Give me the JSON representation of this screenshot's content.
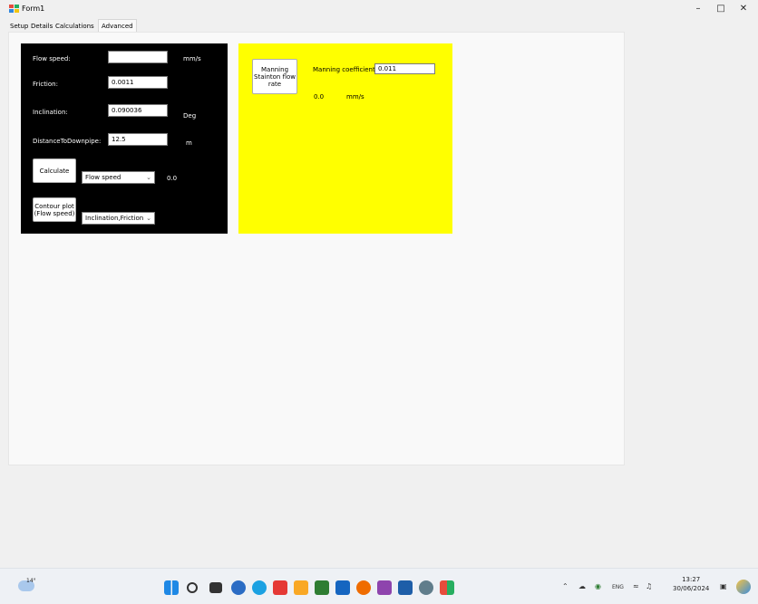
{
  "window": {
    "title": "Form1",
    "minimize": "–",
    "maximize": "□",
    "close": "✕"
  },
  "tabs": [
    "Setup",
    "Details",
    "Calculations",
    "Advanced"
  ],
  "black_panel": {
    "flow_speed_label": "Flow speed:",
    "flow_speed_value": "",
    "flow_speed_unit": "mm/s",
    "friction_label": "Friction:",
    "friction_value": "0.0011",
    "inclination_label": "Inclination:",
    "inclination_value": "0.090036",
    "inclination_unit": "Deg",
    "distance_label": "DistanceToDownpipe:",
    "distance_value": "12.5",
    "distance_unit": "m",
    "calculate_button": "Calculate",
    "calc_select": "Flow speed",
    "calc_result": "0.0",
    "contour_button_line1": "Contour plot",
    "contour_button_line2": "(Flow speed)",
    "contour_select": "Inclination,Friction"
  },
  "yellow_panel": {
    "manning_button_line1": "Manning",
    "manning_button_line2": "Stainton flow",
    "manning_button_line3": "rate",
    "coefficient_label": "Manning coefficient:",
    "coefficient_value": "0.011",
    "result_value": "0.0",
    "result_unit": "mm/s"
  },
  "taskbar": {
    "temperature": "14°",
    "language": "ENG",
    "time": "13:27",
    "date": "30/06/2024"
  },
  "colors": {
    "panel_black": "#000000",
    "panel_yellow": "#ffff00",
    "form_bg": "#f0f0f0"
  }
}
